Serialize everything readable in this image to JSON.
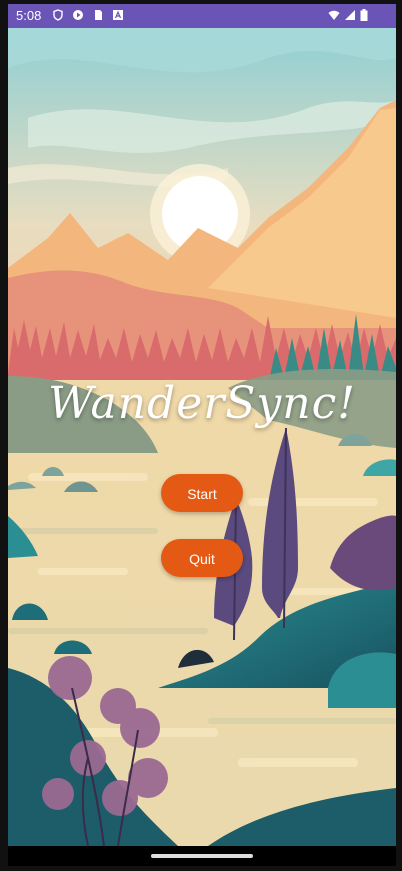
{
  "status_bar": {
    "time": "5:08",
    "icons": [
      "shield-icon",
      "play-protect-icon",
      "sd-card-icon",
      "a-text-icon",
      "wifi-icon",
      "signal-icon",
      "battery-icon"
    ],
    "background_color": "#6a55b7"
  },
  "app": {
    "title": "WanderSync!",
    "start_label": "Start",
    "quit_label": "Quit",
    "button_color": "#e45a14"
  }
}
